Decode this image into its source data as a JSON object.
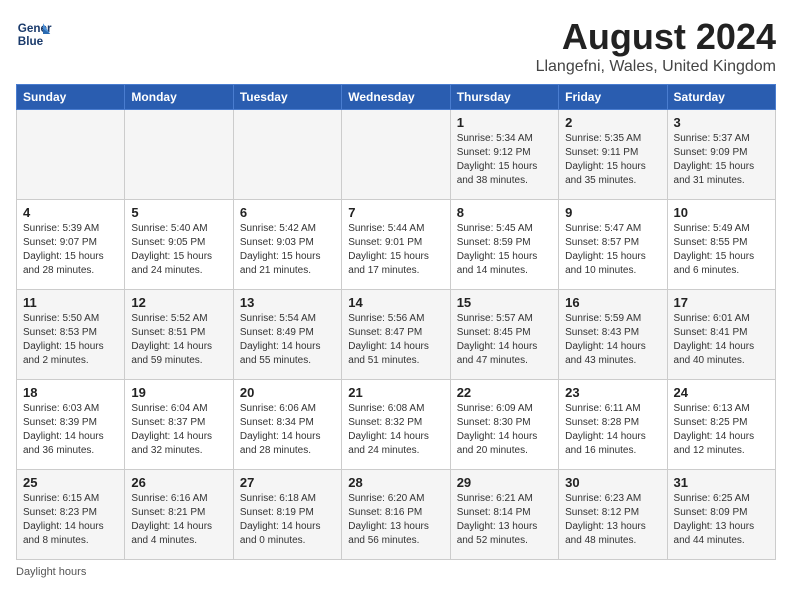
{
  "logo": {
    "line1": "General",
    "line2": "Blue"
  },
  "title": "August 2024",
  "subtitle": "Llangefni, Wales, United Kingdom",
  "days_of_week": [
    "Sunday",
    "Monday",
    "Tuesday",
    "Wednesday",
    "Thursday",
    "Friday",
    "Saturday"
  ],
  "footnote": "Daylight hours",
  "weeks": [
    [
      {
        "num": "",
        "info": ""
      },
      {
        "num": "",
        "info": ""
      },
      {
        "num": "",
        "info": ""
      },
      {
        "num": "",
        "info": ""
      },
      {
        "num": "1",
        "info": "Sunrise: 5:34 AM\nSunset: 9:12 PM\nDaylight: 15 hours\nand 38 minutes."
      },
      {
        "num": "2",
        "info": "Sunrise: 5:35 AM\nSunset: 9:11 PM\nDaylight: 15 hours\nand 35 minutes."
      },
      {
        "num": "3",
        "info": "Sunrise: 5:37 AM\nSunset: 9:09 PM\nDaylight: 15 hours\nand 31 minutes."
      }
    ],
    [
      {
        "num": "4",
        "info": "Sunrise: 5:39 AM\nSunset: 9:07 PM\nDaylight: 15 hours\nand 28 minutes."
      },
      {
        "num": "5",
        "info": "Sunrise: 5:40 AM\nSunset: 9:05 PM\nDaylight: 15 hours\nand 24 minutes."
      },
      {
        "num": "6",
        "info": "Sunrise: 5:42 AM\nSunset: 9:03 PM\nDaylight: 15 hours\nand 21 minutes."
      },
      {
        "num": "7",
        "info": "Sunrise: 5:44 AM\nSunset: 9:01 PM\nDaylight: 15 hours\nand 17 minutes."
      },
      {
        "num": "8",
        "info": "Sunrise: 5:45 AM\nSunset: 8:59 PM\nDaylight: 15 hours\nand 14 minutes."
      },
      {
        "num": "9",
        "info": "Sunrise: 5:47 AM\nSunset: 8:57 PM\nDaylight: 15 hours\nand 10 minutes."
      },
      {
        "num": "10",
        "info": "Sunrise: 5:49 AM\nSunset: 8:55 PM\nDaylight: 15 hours\nand 6 minutes."
      }
    ],
    [
      {
        "num": "11",
        "info": "Sunrise: 5:50 AM\nSunset: 8:53 PM\nDaylight: 15 hours\nand 2 minutes."
      },
      {
        "num": "12",
        "info": "Sunrise: 5:52 AM\nSunset: 8:51 PM\nDaylight: 14 hours\nand 59 minutes."
      },
      {
        "num": "13",
        "info": "Sunrise: 5:54 AM\nSunset: 8:49 PM\nDaylight: 14 hours\nand 55 minutes."
      },
      {
        "num": "14",
        "info": "Sunrise: 5:56 AM\nSunset: 8:47 PM\nDaylight: 14 hours\nand 51 minutes."
      },
      {
        "num": "15",
        "info": "Sunrise: 5:57 AM\nSunset: 8:45 PM\nDaylight: 14 hours\nand 47 minutes."
      },
      {
        "num": "16",
        "info": "Sunrise: 5:59 AM\nSunset: 8:43 PM\nDaylight: 14 hours\nand 43 minutes."
      },
      {
        "num": "17",
        "info": "Sunrise: 6:01 AM\nSunset: 8:41 PM\nDaylight: 14 hours\nand 40 minutes."
      }
    ],
    [
      {
        "num": "18",
        "info": "Sunrise: 6:03 AM\nSunset: 8:39 PM\nDaylight: 14 hours\nand 36 minutes."
      },
      {
        "num": "19",
        "info": "Sunrise: 6:04 AM\nSunset: 8:37 PM\nDaylight: 14 hours\nand 32 minutes."
      },
      {
        "num": "20",
        "info": "Sunrise: 6:06 AM\nSunset: 8:34 PM\nDaylight: 14 hours\nand 28 minutes."
      },
      {
        "num": "21",
        "info": "Sunrise: 6:08 AM\nSunset: 8:32 PM\nDaylight: 14 hours\nand 24 minutes."
      },
      {
        "num": "22",
        "info": "Sunrise: 6:09 AM\nSunset: 8:30 PM\nDaylight: 14 hours\nand 20 minutes."
      },
      {
        "num": "23",
        "info": "Sunrise: 6:11 AM\nSunset: 8:28 PM\nDaylight: 14 hours\nand 16 minutes."
      },
      {
        "num": "24",
        "info": "Sunrise: 6:13 AM\nSunset: 8:25 PM\nDaylight: 14 hours\nand 12 minutes."
      }
    ],
    [
      {
        "num": "25",
        "info": "Sunrise: 6:15 AM\nSunset: 8:23 PM\nDaylight: 14 hours\nand 8 minutes."
      },
      {
        "num": "26",
        "info": "Sunrise: 6:16 AM\nSunset: 8:21 PM\nDaylight: 14 hours\nand 4 minutes."
      },
      {
        "num": "27",
        "info": "Sunrise: 6:18 AM\nSunset: 8:19 PM\nDaylight: 14 hours\nand 0 minutes."
      },
      {
        "num": "28",
        "info": "Sunrise: 6:20 AM\nSunset: 8:16 PM\nDaylight: 13 hours\nand 56 minutes."
      },
      {
        "num": "29",
        "info": "Sunrise: 6:21 AM\nSunset: 8:14 PM\nDaylight: 13 hours\nand 52 minutes."
      },
      {
        "num": "30",
        "info": "Sunrise: 6:23 AM\nSunset: 8:12 PM\nDaylight: 13 hours\nand 48 minutes."
      },
      {
        "num": "31",
        "info": "Sunrise: 6:25 AM\nSunset: 8:09 PM\nDaylight: 13 hours\nand 44 minutes."
      }
    ]
  ]
}
